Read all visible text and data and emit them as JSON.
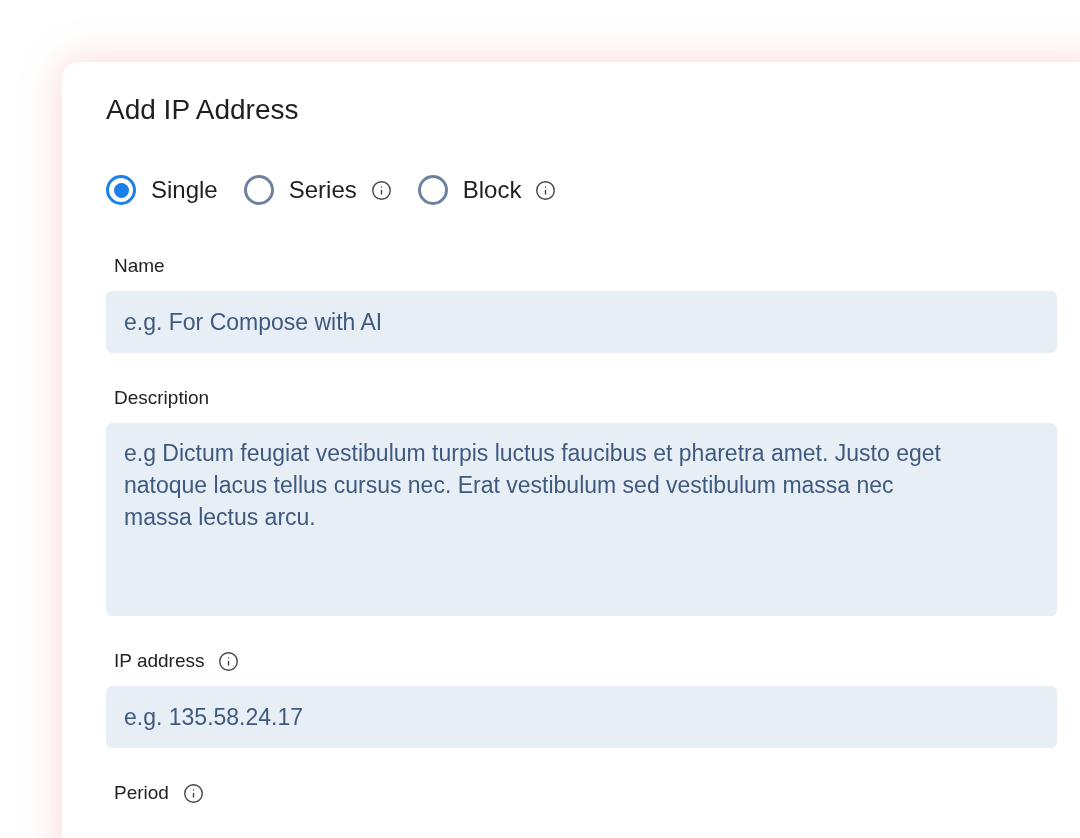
{
  "dialog": {
    "title": "Add IP Address"
  },
  "type_options": [
    {
      "label": "Single",
      "selected": true,
      "info": false
    },
    {
      "label": "Series",
      "selected": false,
      "info": true
    },
    {
      "label": "Block",
      "selected": false,
      "info": true
    }
  ],
  "fields": [
    {
      "kind": "text",
      "label": "Name",
      "info": false,
      "placeholder": "e.g. For Compose with AI"
    },
    {
      "kind": "textarea",
      "label": "Description",
      "info": false,
      "placeholder": "e.g Dictum feugiat vestibulum turpis luctus faucibus et pharetra amet. Justo eget natoque lacus tellus cursus nec. Erat vestibulum sed vestibulum massa nec massa lectus arcu."
    },
    {
      "kind": "text",
      "label": "IP address",
      "info": true,
      "placeholder": "e.g. 135.58.24.17"
    },
    {
      "kind": "none",
      "label": "Period",
      "info": true
    }
  ]
}
